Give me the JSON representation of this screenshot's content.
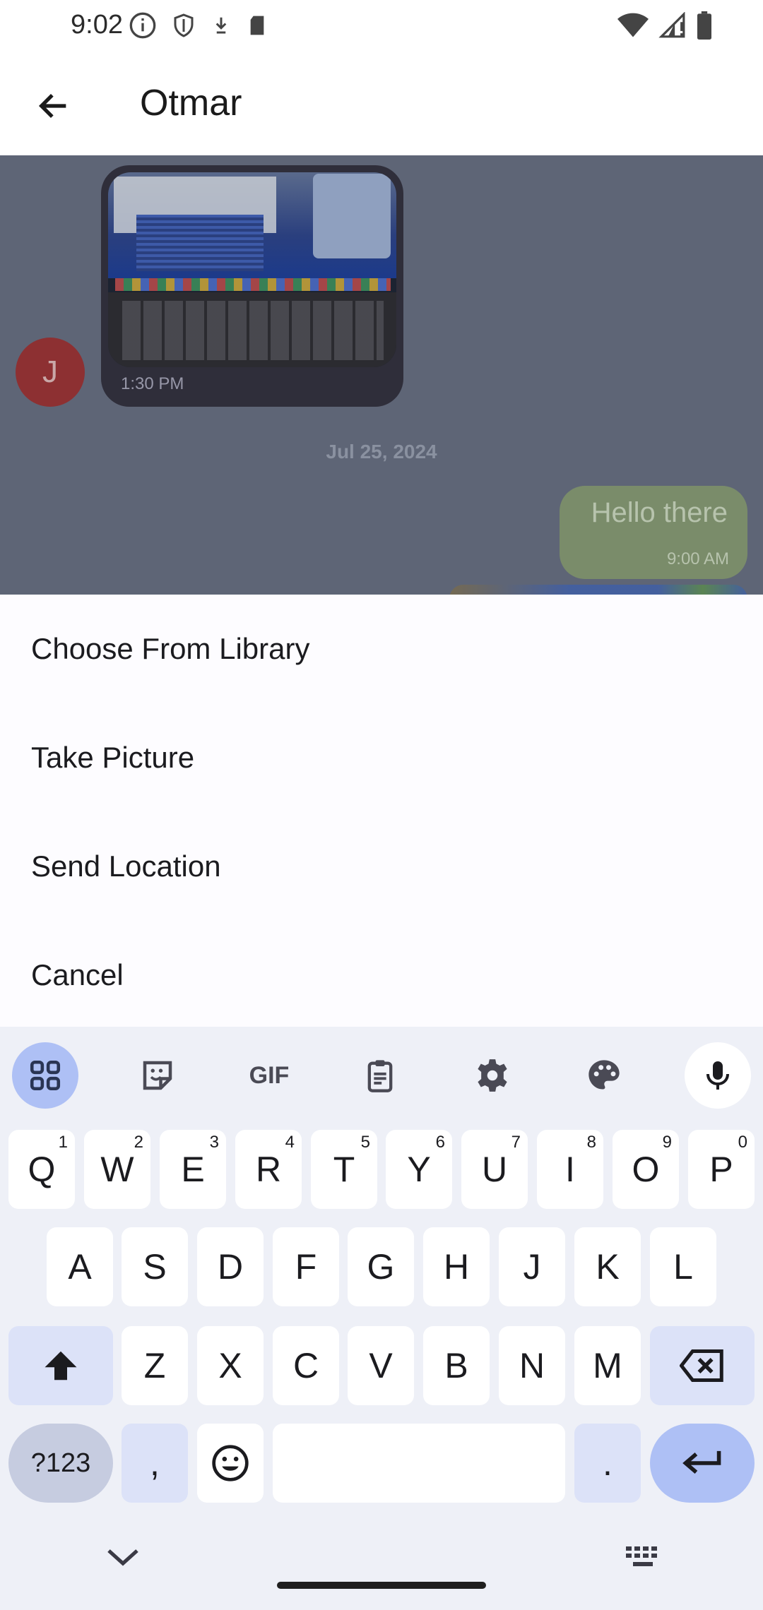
{
  "status_bar": {
    "time": "9:02",
    "left_icons": [
      "info-icon",
      "shield-icon",
      "download-icon",
      "sd-card-icon"
    ],
    "right_icons": [
      "wifi-icon",
      "signal-icon",
      "battery-icon"
    ]
  },
  "app_bar": {
    "title": "Otmar",
    "back_icon": "arrow-back-icon"
  },
  "chat": {
    "avatar_initial": "J",
    "image_message_time": "1:30 PM",
    "date_separator": "Jul 25, 2024",
    "outgoing_text": "Hello there",
    "outgoing_time": "9:00 AM"
  },
  "action_sheet": {
    "items": [
      "Choose From Library",
      "Take Picture",
      "Send Location",
      "Cancel"
    ]
  },
  "keyboard": {
    "toolbar_icons": [
      "apps-grid-icon",
      "sticker-icon",
      "gif-icon",
      "clipboard-icon",
      "settings-icon",
      "palette-icon",
      "mic-icon"
    ],
    "gif_label": "GIF",
    "row1": [
      {
        "key": "Q",
        "hint": "1"
      },
      {
        "key": "W",
        "hint": "2"
      },
      {
        "key": "E",
        "hint": "3"
      },
      {
        "key": "R",
        "hint": "4"
      },
      {
        "key": "T",
        "hint": "5"
      },
      {
        "key": "Y",
        "hint": "6"
      },
      {
        "key": "U",
        "hint": "7"
      },
      {
        "key": "I",
        "hint": "8"
      },
      {
        "key": "O",
        "hint": "9"
      },
      {
        "key": "P",
        "hint": "0"
      }
    ],
    "row2": [
      "A",
      "S",
      "D",
      "F",
      "G",
      "H",
      "J",
      "K",
      "L"
    ],
    "row3": [
      "Z",
      "X",
      "C",
      "V",
      "B",
      "N",
      "M"
    ],
    "symbols_label": "?123",
    "comma_label": ",",
    "period_label": ".",
    "space_label": ""
  },
  "colors": {
    "chat_background": "#5e6576",
    "keyboard_accent": "#aec0f5",
    "avatar": "#8d3032"
  }
}
